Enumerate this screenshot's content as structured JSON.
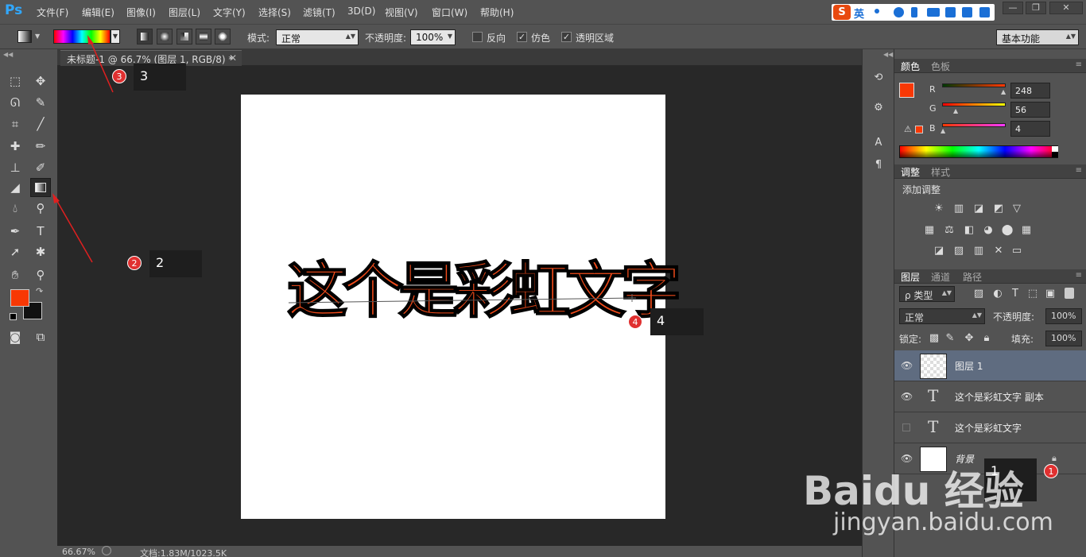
{
  "app": {
    "logo": "Ps"
  },
  "menu": [
    "文件(F)",
    "编辑(E)",
    "图像(I)",
    "图层(L)",
    "文字(Y)",
    "选择(S)",
    "滤镜(T)",
    "3D(D)",
    "视图(V)",
    "窗口(W)",
    "帮助(H)"
  ],
  "ime": {
    "logo": "S",
    "lang": "英"
  },
  "window_controls": [
    "—",
    "❐",
    "✕"
  ],
  "options": {
    "mode_label": "模式:",
    "mode_value": "正常",
    "opacity_label": "不透明度:",
    "opacity_value": "100%",
    "reverse_label": "反向",
    "reverse_checked": false,
    "dither_label": "仿色",
    "dither_checked": true,
    "transparency_label": "透明区域",
    "transparency_checked": true,
    "workspace": "基本功能"
  },
  "document": {
    "tab_title": "未标题-1 @ 66.7% (图层 1, RGB/8) *",
    "canvas_text": "这个是彩虹文字",
    "zoom": "66.67%",
    "doc_info": "文档:1.83M/1023.5K"
  },
  "colors": {
    "foreground": "#f83804",
    "background": "#111111",
    "tabs": [
      "颜色",
      "色板"
    ],
    "r_label": "R",
    "r_value": "248",
    "g_label": "G",
    "g_value": "56",
    "b_label": "B",
    "b_value": "4"
  },
  "adjustments": {
    "tabs": [
      "调整",
      "样式"
    ],
    "title": "添加调整",
    "icons": [
      "☀",
      "▥",
      "◪",
      "◩",
      "▽",
      "▦",
      "⚖",
      "◧",
      "◕",
      "⬤",
      "▦",
      "◪",
      "▨",
      "▥",
      "✕",
      "▭"
    ]
  },
  "layers": {
    "tabs": [
      "图层",
      "通道",
      "路径"
    ],
    "filter_value": "ρ 类型",
    "blend_value": "正常",
    "opacity_label": "不透明度:",
    "opacity_value": "100%",
    "lock_label": "锁定:",
    "fill_label": "填充:",
    "fill_value": "100%",
    "items": [
      {
        "name": "图层 1",
        "type": "pixel",
        "visible": true
      },
      {
        "name": "这个是彩虹文字 副本",
        "type": "text",
        "visible": true
      },
      {
        "name": "这个是彩虹文字",
        "type": "text",
        "visible": false
      },
      {
        "name": "背景",
        "type": "background",
        "visible": true
      }
    ]
  },
  "annotations": [
    {
      "num": "1",
      "label": "1"
    },
    {
      "num": "2",
      "label": "2"
    },
    {
      "num": "3",
      "label": "3"
    },
    {
      "num": "4",
      "label": "4"
    }
  ],
  "watermark": {
    "text": "Baidu 经验",
    "url": "jingyan.baidu.com"
  }
}
